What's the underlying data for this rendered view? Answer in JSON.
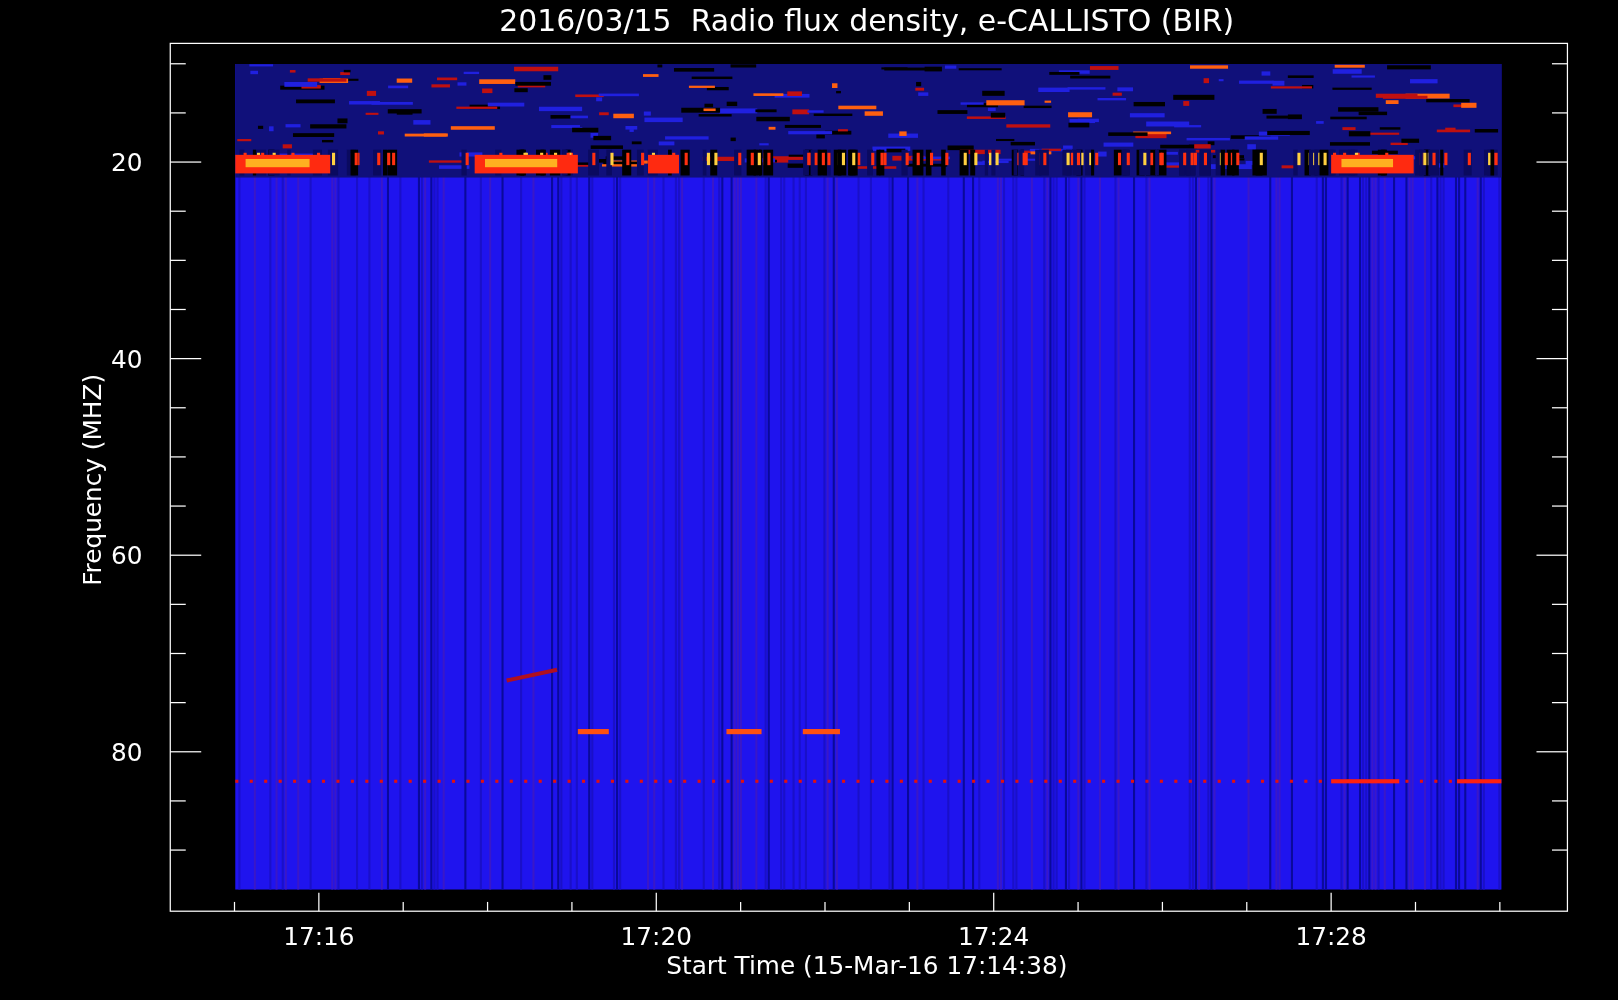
{
  "plot": {
    "title": "2016/03/15  Radio flux density, e-CALLISTO (BIR)",
    "xlabel": "Start Time (15-Mar-16 17:14:38)",
    "ylabel": "Frequency (MHZ)",
    "xticks": [
      "17:16",
      "17:20",
      "17:24",
      "17:28"
    ],
    "yticks": [
      "20",
      "40",
      "60",
      "80"
    ]
  }
}
